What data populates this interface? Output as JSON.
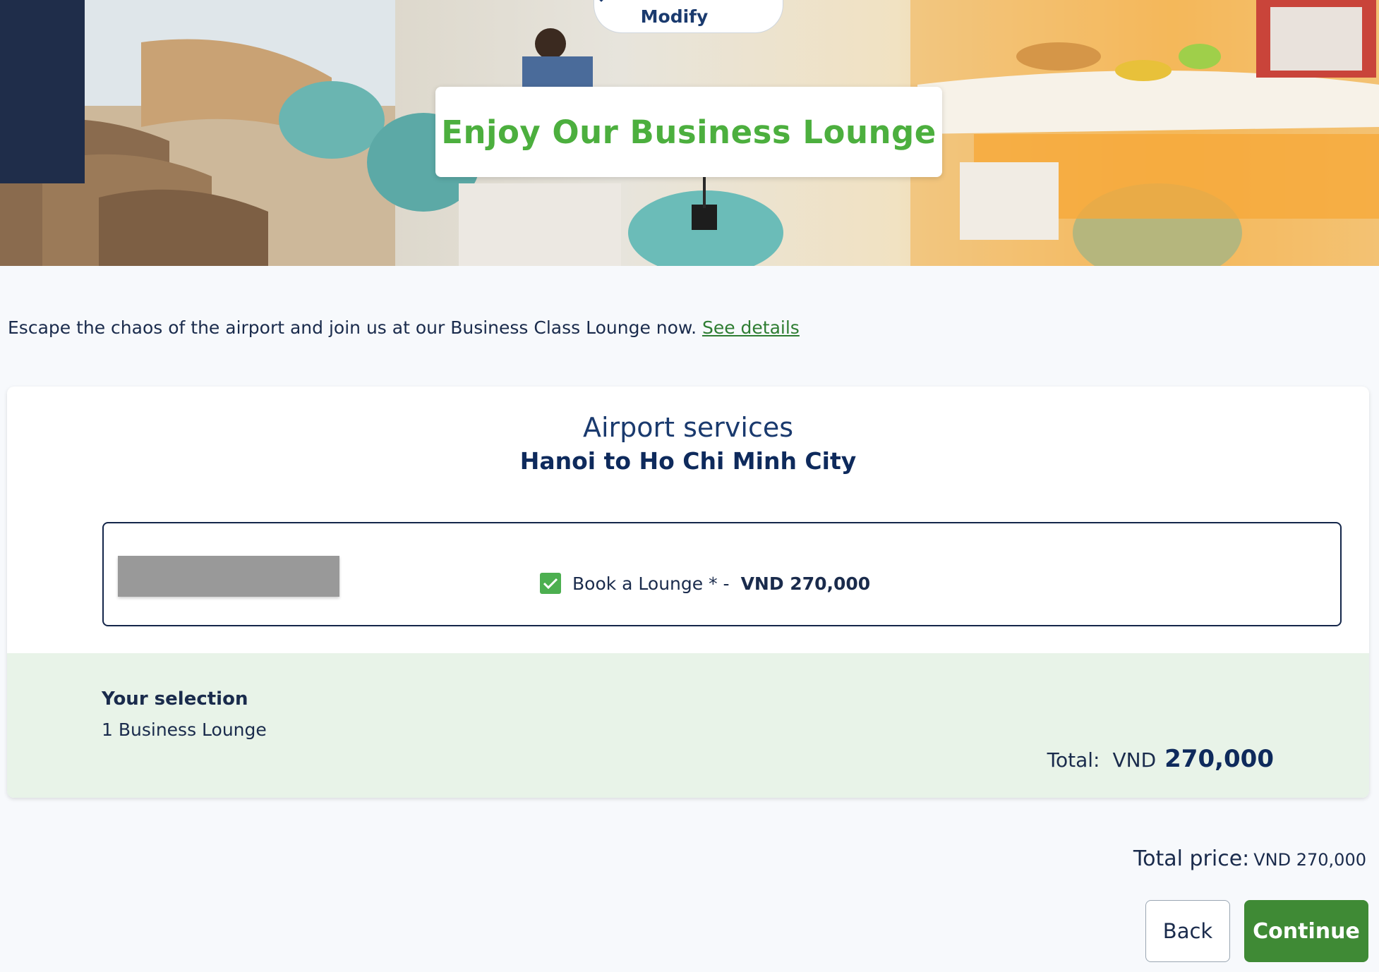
{
  "hero": {
    "modify_label": "Modify",
    "title": "Enjoy Our Business Lounge"
  },
  "intro": {
    "text": "Escape the chaos of the airport and join us at our Business Class Lounge now.",
    "link_label": "See details"
  },
  "card": {
    "title": "Airport services",
    "route": "Hanoi to Ho Chi Minh City"
  },
  "service": {
    "option_label": "Book a Lounge * -",
    "option_price": "VND 270,000",
    "checked": true
  },
  "selection": {
    "title": "Your selection",
    "item": "1 Business Lounge",
    "total_label": "Total:",
    "total_currency": "VND",
    "total_amount": "270,000"
  },
  "footer": {
    "total_price_label": "Total price:",
    "total_price_value": "VND 270,000",
    "back_label": "Back",
    "continue_label": "Continue"
  },
  "colors": {
    "accent_green": "#4caf3e",
    "button_green": "#3f8a35",
    "navy": "#0e2a5c",
    "selection_bg": "#e8f3e8"
  },
  "icons": {
    "modify": "chevron-down-icon",
    "checkbox": "check-icon"
  }
}
